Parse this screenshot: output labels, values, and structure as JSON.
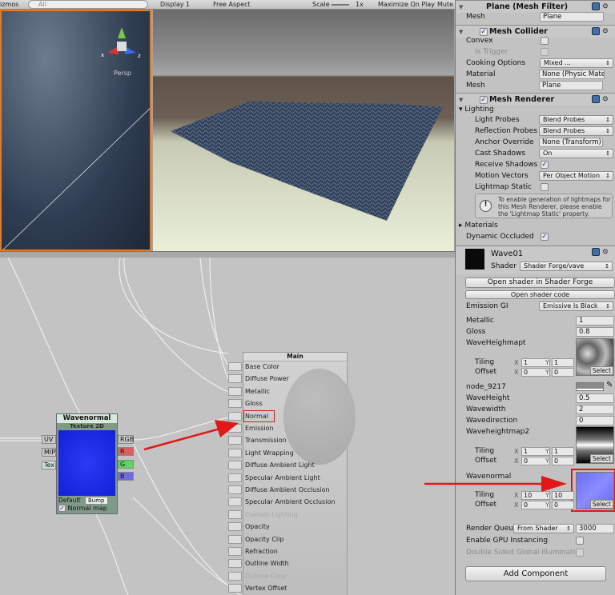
{
  "toolbar": {
    "gizmos": "izmos",
    "search_placeholder": "All",
    "display": "Display 1",
    "aspect": "Free Aspect",
    "scale_label": "Scale",
    "scale_value": "1x",
    "maximize": "Maximize On Play",
    "mute": "Mute"
  },
  "scene": {
    "persp": "Persp",
    "axis_x": "x",
    "axis_z": "z"
  },
  "inspector": {
    "mesh_filter": {
      "title": "Plane (Mesh Filter)",
      "mesh_label": "Mesh",
      "mesh_value": "Plane"
    },
    "mesh_collider": {
      "title": "Mesh Collider",
      "convex": "Convex",
      "is_trigger": "Is Trigger",
      "cooking_label": "Cooking Options",
      "cooking_value": "Mixed ...",
      "material_label": "Material",
      "material_value": "None (Physic Mate",
      "mesh_label": "Mesh",
      "mesh_value": "Plane"
    },
    "mesh_renderer": {
      "title": "Mesh Renderer",
      "lighting": "Lighting",
      "light_probes": "Light Probes",
      "light_probes_value": "Blend Probes",
      "reflection_probes": "Reflection Probes",
      "reflection_probes_value": "Blend Probes",
      "anchor_override": "Anchor Override",
      "anchor_override_value": "None (Transform)",
      "cast_shadows": "Cast Shadows",
      "cast_shadows_value": "On",
      "receive_shadows": "Receive Shadows",
      "motion_vectors": "Motion Vectors",
      "motion_vectors_value": "Per Object Motion",
      "lightmap_static": "Lightmap Static",
      "help": "To enable generation of lightmaps for this Mesh Renderer, please enable the 'Lightmap Static' property.",
      "materials": "Materials",
      "dynamic_occluded": "Dynamic Occluded"
    },
    "material": {
      "name": "Wave01",
      "shader_label": "Shader",
      "shader_value": "Shader Forge/vave",
      "open_sf": "Open shader in Shader Forge",
      "open_code": "Open shader code",
      "emission_gi": "Emission GI",
      "emission_gi_value": "Emissive Is Black",
      "metallic": "Metallic",
      "metallic_value": "1",
      "gloss": "Gloss",
      "gloss_value": "0.8",
      "tex1": "WaveHeighmapt",
      "tex1_tiling": [
        "1",
        "1"
      ],
      "tex1_offset": [
        "0",
        "0"
      ],
      "node": "node_9217",
      "waveheight": "WaveHeight",
      "waveheight_value": "0.5",
      "wavewidth": "Wavewidth",
      "wavewidth_value": "2",
      "wavedirection": "Wavedirection",
      "wavedirection_value": "0",
      "tex2": "Waveheightmap2",
      "tex2_tiling": [
        "1",
        "1"
      ],
      "tex2_offset": [
        "0",
        "0"
      ],
      "tex3": "Wavenormal",
      "tex3_tiling": [
        "10",
        "10"
      ],
      "tex3_offset": [
        "0",
        "0"
      ],
      "tiling": "Tiling",
      "offset": "Offset",
      "x": "X",
      "y": "Y",
      "select": "Select",
      "render_queue": "Render Queu",
      "render_queue_value": "From Shader",
      "render_queue_num": "3000",
      "gpu_instancing": "Enable GPU Instancing",
      "double_sided": "Double Sided Global Illuminatio"
    },
    "add_component": "Add Component"
  },
  "node_editor": {
    "main": {
      "title": "Main",
      "items": [
        "Base Color",
        "Diffuse Power",
        "Metallic",
        "Gloss",
        "Normal",
        "Emission",
        "Transmission",
        "Light Wrapping",
        "Diffuse Ambient Light",
        "Specular Ambient Light",
        "Diffuse Ambient Occlusion",
        "Specular Ambient Occlusion",
        "Custom Lighting",
        "Opacity",
        "Opacity Clip",
        "Refraction",
        "Outline Width",
        "Outline Color",
        "Vertex Offset"
      ],
      "disabled": [
        12,
        17
      ]
    },
    "texture_node": {
      "title": "Wavenormal",
      "subtitle": "Texture 2D",
      "inputs": [
        "UV",
        "MIP",
        "Tex"
      ],
      "outputs": [
        "RGB",
        "R",
        "G",
        "B"
      ],
      "default_label": "Default",
      "default_value": "Bump",
      "normal_map": "Normal map"
    }
  },
  "colors": {
    "highlight": "#e01818",
    "scene_border": "#e07b2a"
  }
}
